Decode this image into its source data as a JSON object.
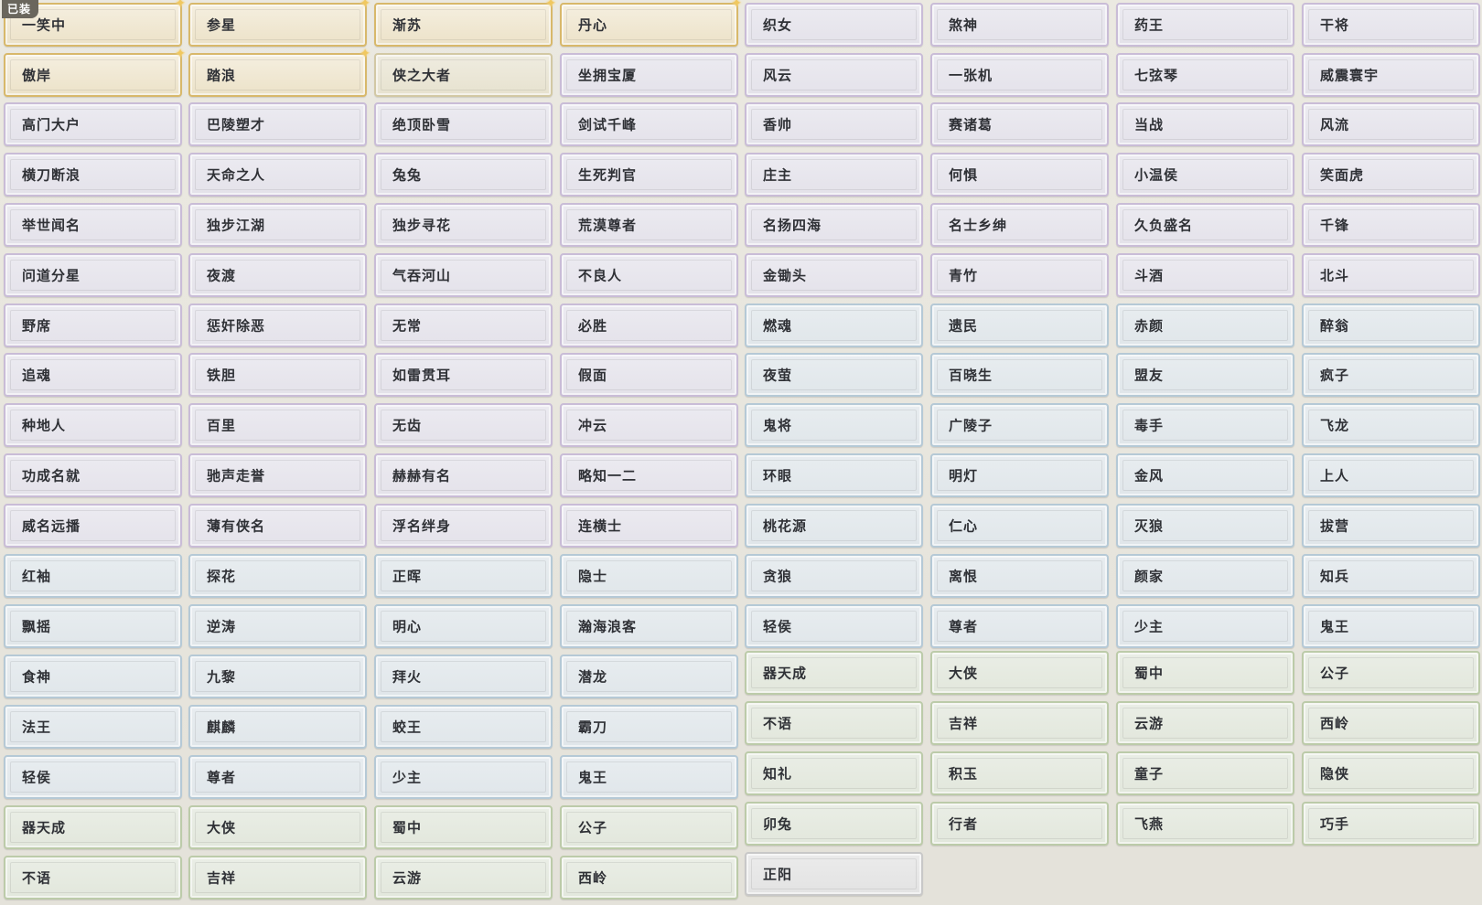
{
  "equipped_badge": "已装",
  "colors": {
    "gold": "#d8b86a",
    "tan": "#d2c8a4",
    "purple": "#c9bcd7",
    "blue": "#b5c9d6",
    "green": "#bccba9"
  },
  "columns": [
    [
      {
        "label": "一笑中",
        "rarity": "gold",
        "starred": true
      },
      {
        "label": "傲岸",
        "rarity": "gold",
        "starred": true
      },
      {
        "label": "高门大户",
        "rarity": "purple"
      },
      {
        "label": "横刀断浪",
        "rarity": "purple"
      },
      {
        "label": "举世闻名",
        "rarity": "purple"
      },
      {
        "label": "问道分星",
        "rarity": "purple"
      },
      {
        "label": "野席",
        "rarity": "purple"
      },
      {
        "label": "追魂",
        "rarity": "purple"
      },
      {
        "label": "种地人",
        "rarity": "purple"
      },
      {
        "label": "功成名就",
        "rarity": "purple"
      },
      {
        "label": "威名远播",
        "rarity": "purple"
      },
      {
        "label": "红袖",
        "rarity": "blue"
      },
      {
        "label": "飘摇",
        "rarity": "blue"
      },
      {
        "label": "食神",
        "rarity": "blue"
      },
      {
        "label": "法王",
        "rarity": "blue"
      },
      {
        "label": "轻侯",
        "rarity": "blue"
      },
      {
        "label": "器天成",
        "rarity": "green"
      },
      {
        "label": "不语",
        "rarity": "green"
      }
    ],
    [
      {
        "label": "参星",
        "rarity": "gold",
        "starred": true
      },
      {
        "label": "踏浪",
        "rarity": "gold",
        "starred": true
      },
      {
        "label": "巴陵塑才",
        "rarity": "purple"
      },
      {
        "label": "天命之人",
        "rarity": "purple"
      },
      {
        "label": "独步江湖",
        "rarity": "purple"
      },
      {
        "label": "夜渡",
        "rarity": "purple"
      },
      {
        "label": "惩奸除恶",
        "rarity": "purple"
      },
      {
        "label": "铁胆",
        "rarity": "purple"
      },
      {
        "label": "百里",
        "rarity": "purple"
      },
      {
        "label": "驰声走誉",
        "rarity": "purple"
      },
      {
        "label": "薄有侠名",
        "rarity": "purple"
      },
      {
        "label": "探花",
        "rarity": "blue"
      },
      {
        "label": "逆涛",
        "rarity": "blue"
      },
      {
        "label": "九黎",
        "rarity": "blue"
      },
      {
        "label": "麒麟",
        "rarity": "blue"
      },
      {
        "label": "尊者",
        "rarity": "blue"
      },
      {
        "label": "大侠",
        "rarity": "green"
      },
      {
        "label": "吉祥",
        "rarity": "green"
      }
    ],
    [
      {
        "label": "渐苏",
        "rarity": "gold",
        "starred": true
      },
      {
        "label": "侠之大者",
        "rarity": "tan"
      },
      {
        "label": "绝顶卧雪",
        "rarity": "purple"
      },
      {
        "label": "兔兔",
        "rarity": "purple"
      },
      {
        "label": "独步寻花",
        "rarity": "purple"
      },
      {
        "label": "气吞河山",
        "rarity": "purple"
      },
      {
        "label": "无常",
        "rarity": "purple"
      },
      {
        "label": "如雷贯耳",
        "rarity": "purple"
      },
      {
        "label": "无齿",
        "rarity": "purple"
      },
      {
        "label": "赫赫有名",
        "rarity": "purple"
      },
      {
        "label": "浮名绊身",
        "rarity": "purple"
      },
      {
        "label": "正晖",
        "rarity": "blue"
      },
      {
        "label": "明心",
        "rarity": "blue"
      },
      {
        "label": "拜火",
        "rarity": "blue"
      },
      {
        "label": "蛟王",
        "rarity": "blue"
      },
      {
        "label": "少主",
        "rarity": "blue"
      },
      {
        "label": "蜀中",
        "rarity": "green"
      },
      {
        "label": "云游",
        "rarity": "green"
      }
    ],
    [
      {
        "label": "丹心",
        "rarity": "gold",
        "starred": true
      },
      {
        "label": "坐拥宝厦",
        "rarity": "purple"
      },
      {
        "label": "剑试千峰",
        "rarity": "purple"
      },
      {
        "label": "生死判官",
        "rarity": "purple"
      },
      {
        "label": "荒漠尊者",
        "rarity": "purple"
      },
      {
        "label": "不良人",
        "rarity": "purple"
      },
      {
        "label": "必胜",
        "rarity": "purple"
      },
      {
        "label": "假面",
        "rarity": "purple"
      },
      {
        "label": "冲云",
        "rarity": "purple"
      },
      {
        "label": "略知一二",
        "rarity": "purple"
      },
      {
        "label": "连横士",
        "rarity": "purple"
      },
      {
        "label": "隐士",
        "rarity": "blue"
      },
      {
        "label": "瀚海浪客",
        "rarity": "blue"
      },
      {
        "label": "潜龙",
        "rarity": "blue"
      },
      {
        "label": "霸刀",
        "rarity": "blue"
      },
      {
        "label": "鬼王",
        "rarity": "blue"
      },
      {
        "label": "公子",
        "rarity": "green"
      },
      {
        "label": "西岭",
        "rarity": "green"
      }
    ],
    [
      {
        "label": "织女",
        "rarity": "purple"
      },
      {
        "label": "风云",
        "rarity": "purple"
      },
      {
        "label": "香帅",
        "rarity": "purple"
      },
      {
        "label": "庄主",
        "rarity": "purple"
      },
      {
        "label": "名扬四海",
        "rarity": "purple"
      },
      {
        "label": "金锄头",
        "rarity": "purple"
      },
      {
        "label": "燃魂",
        "rarity": "blue"
      },
      {
        "label": "夜萤",
        "rarity": "blue"
      },
      {
        "label": "鬼将",
        "rarity": "blue"
      },
      {
        "label": "环眼",
        "rarity": "blue"
      },
      {
        "label": "桃花源",
        "rarity": "blue"
      },
      {
        "label": "贪狼",
        "rarity": "blue"
      },
      {
        "label": "轻侯",
        "rarity": "blue"
      },
      {
        "label": "器天成",
        "rarity": "green"
      },
      {
        "label": "不语",
        "rarity": "green"
      },
      {
        "label": "知礼",
        "rarity": "green"
      },
      {
        "label": "卯兔",
        "rarity": "green"
      },
      {
        "label": "正阳",
        "rarity": "gray"
      }
    ],
    [
      {
        "label": "煞神",
        "rarity": "purple"
      },
      {
        "label": "一张机",
        "rarity": "purple"
      },
      {
        "label": "赛诸葛",
        "rarity": "purple"
      },
      {
        "label": "何惧",
        "rarity": "purple"
      },
      {
        "label": "名士乡绅",
        "rarity": "purple"
      },
      {
        "label": "青竹",
        "rarity": "purple"
      },
      {
        "label": "遗民",
        "rarity": "blue"
      },
      {
        "label": "百晓生",
        "rarity": "blue"
      },
      {
        "label": "广陵子",
        "rarity": "blue"
      },
      {
        "label": "明灯",
        "rarity": "blue"
      },
      {
        "label": "仁心",
        "rarity": "blue"
      },
      {
        "label": "离恨",
        "rarity": "blue"
      },
      {
        "label": "尊者",
        "rarity": "blue"
      },
      {
        "label": "大侠",
        "rarity": "green"
      },
      {
        "label": "吉祥",
        "rarity": "green"
      },
      {
        "label": "积玉",
        "rarity": "green"
      },
      {
        "label": "行者",
        "rarity": "green"
      }
    ],
    [
      {
        "label": "药王",
        "rarity": "purple"
      },
      {
        "label": "七弦琴",
        "rarity": "purple"
      },
      {
        "label": "当战",
        "rarity": "purple"
      },
      {
        "label": "小温侯",
        "rarity": "purple"
      },
      {
        "label": "久负盛名",
        "rarity": "purple"
      },
      {
        "label": "斗酒",
        "rarity": "purple"
      },
      {
        "label": "赤颜",
        "rarity": "blue"
      },
      {
        "label": "盟友",
        "rarity": "blue"
      },
      {
        "label": "毒手",
        "rarity": "blue"
      },
      {
        "label": "金风",
        "rarity": "blue"
      },
      {
        "label": "灭狼",
        "rarity": "blue"
      },
      {
        "label": "颜家",
        "rarity": "blue"
      },
      {
        "label": "少主",
        "rarity": "blue"
      },
      {
        "label": "蜀中",
        "rarity": "green"
      },
      {
        "label": "云游",
        "rarity": "green"
      },
      {
        "label": "童子",
        "rarity": "green"
      },
      {
        "label": "飞燕",
        "rarity": "green"
      }
    ],
    [
      {
        "label": "干将",
        "rarity": "purple"
      },
      {
        "label": "威震寰宇",
        "rarity": "purple"
      },
      {
        "label": "风流",
        "rarity": "purple"
      },
      {
        "label": "笑面虎",
        "rarity": "purple"
      },
      {
        "label": "千锋",
        "rarity": "purple"
      },
      {
        "label": "北斗",
        "rarity": "purple"
      },
      {
        "label": "醉翁",
        "rarity": "blue"
      },
      {
        "label": "疯子",
        "rarity": "blue"
      },
      {
        "label": "飞龙",
        "rarity": "blue"
      },
      {
        "label": "上人",
        "rarity": "blue"
      },
      {
        "label": "拔营",
        "rarity": "blue"
      },
      {
        "label": "知兵",
        "rarity": "blue"
      },
      {
        "label": "鬼王",
        "rarity": "blue"
      },
      {
        "label": "公子",
        "rarity": "green"
      },
      {
        "label": "西岭",
        "rarity": "green"
      },
      {
        "label": "隐侠",
        "rarity": "green"
      },
      {
        "label": "巧手",
        "rarity": "green"
      }
    ]
  ]
}
